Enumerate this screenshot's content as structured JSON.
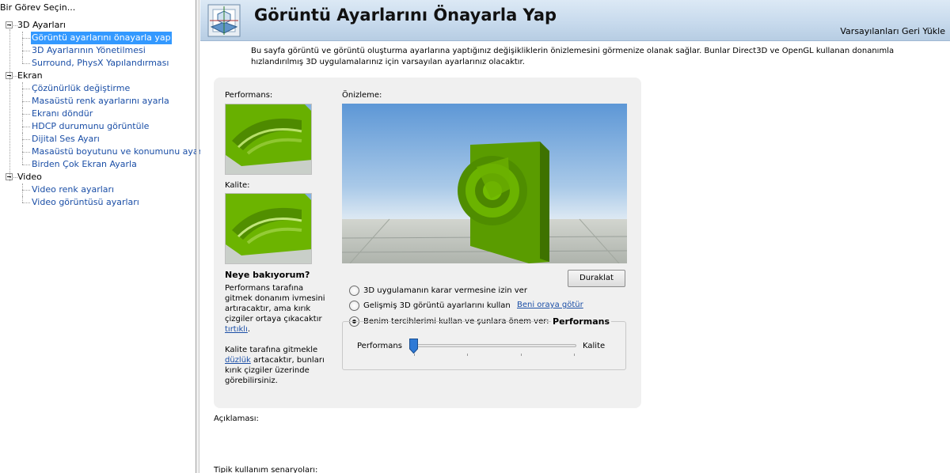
{
  "sidebar": {
    "title": "Bir Görev Seçin...",
    "groups": [
      {
        "label": "3D Ayarları",
        "items": [
          "Görüntü ayarlarını önayarla yap",
          "3D Ayarlarının Yönetilmesi",
          "Surround, PhysX Yapılandırması"
        ]
      },
      {
        "label": "Ekran",
        "items": [
          "Çözünürlük değiştirme",
          "Masaüstü renk ayarlarını ayarla",
          "Ekranı döndür",
          "HDCP durumunu görüntüle",
          "Dijital Ses Ayarı",
          "Masaüstü boyutunu ve konumunu ayarla",
          "Birden Çok Ekran Ayarla"
        ]
      },
      {
        "label": "Video",
        "items": [
          "Video renk ayarları",
          "Video görüntüsü ayarları"
        ]
      }
    ],
    "selected": "Görüntü ayarlarını önayarla yap"
  },
  "header": {
    "title": "Görüntü Ayarlarını Önayarla Yap",
    "restore_defaults": "Varsayılanları Geri Yükle"
  },
  "intro": "Bu sayfa görüntü ve görüntü oluşturma ayarlarına yaptığınız değişikliklerin önizlemesini görmenize olanak sağlar. Bunlar Direct3D ve OpenGL kullanan donanımla hızlandırılmış 3D uygulamalarınız için varsayılan ayarlarınız olacaktır.",
  "panel": {
    "performance_label": "Performans:",
    "quality_label": "Kalite:",
    "preview_label": "Önizleme:",
    "what_look_title": "Neye bakıyorum?",
    "perf_desc_pre": "Performans tarafına gitmek donanım ivmesini artıracaktır, ama kırık çizgiler ortaya çıkacaktır",
    "perf_desc_link": "tırtıklı",
    "perf_desc_post": ".",
    "qual_desc_pre": "Kalite tarafına  gitmekle",
    "qual_desc_link": "düzlük",
    "qual_desc_post": "artacaktır, bunları kırık çizgiler üzerinde görebilirsiniz.",
    "pause_button": "Duraklat",
    "options": [
      {
        "label": "3D uygulamanın karar vermesine izin ver",
        "selected": false
      },
      {
        "label": "Gelişmiş 3D görüntü ayarlarını kullan",
        "selected": false
      },
      {
        "label": "Benim tercihlerimi kullan ve şunlara önem ver:",
        "selected": true
      }
    ],
    "goto_link": "Beni oraya götür",
    "preference_group_value": "Performans",
    "slider": {
      "left_label": "Performans",
      "right_label": "Kalite",
      "value_fraction": 0.0,
      "ticks": 4
    }
  },
  "description_label": "Açıklaması:",
  "usage_label": "Tipik kullanım senaryoları:",
  "colors": {
    "accent": "#3399ff",
    "link": "#1a4ea6",
    "nvidia_green": "#76b900"
  }
}
